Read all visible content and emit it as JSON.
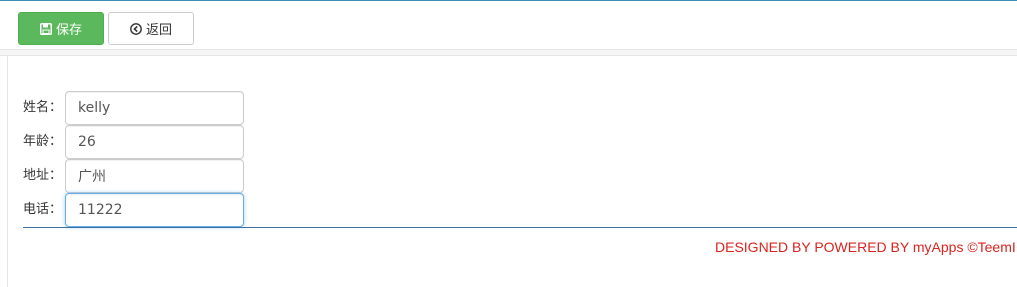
{
  "toolbar": {
    "save_label": "保存",
    "back_label": "返回",
    "save_color": "#5cb85c"
  },
  "form": {
    "fields": [
      {
        "label": "姓名：",
        "value": "kelly"
      },
      {
        "label": "年龄：",
        "value": "26"
      },
      {
        "label": "地址：",
        "value": "广州"
      },
      {
        "label": "电话：",
        "value": "11222"
      }
    ]
  },
  "footer": {
    "text": "DESIGNED BY POWERED BY myApps ©TeemI",
    "color": "#d9241f"
  },
  "icons": {
    "save": "floppy-disk-icon",
    "back": "circle-arrow-left-icon"
  }
}
